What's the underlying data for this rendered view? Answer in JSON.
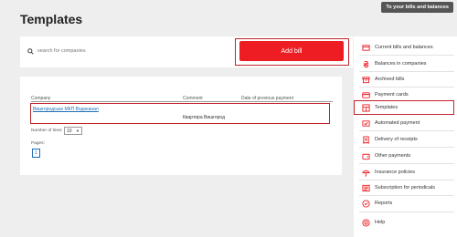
{
  "page": {
    "title": "Templates"
  },
  "header": {
    "top_link": "To your bills and balances"
  },
  "search": {
    "placeholder": "search for companies",
    "value": ""
  },
  "actions": {
    "add_bill": "Add bill"
  },
  "table": {
    "columns": [
      "Company",
      "Comment",
      "Date of previous payment"
    ],
    "rows": [
      {
        "company": "Вишгородське МКП Водоканал",
        "comment": "Квартира Вишгород",
        "date": ""
      }
    ]
  },
  "pagination": {
    "lines_label": "Number of lines",
    "lines_value": "10",
    "pages_label": "Pages:",
    "current_page": "1"
  },
  "menu": {
    "items": [
      {
        "label": "Current bills and balances",
        "icon": "bills-icon"
      },
      {
        "label": "Balances in companies",
        "icon": "hryvnia-icon"
      },
      {
        "label": "Archived bills",
        "icon": "archive-icon"
      },
      {
        "label": "Payment cards",
        "icon": "card-icon"
      },
      {
        "label": "Templates",
        "icon": "template-icon"
      },
      {
        "label": "Automated payment",
        "icon": "autopay-icon"
      },
      {
        "label": "Delivery of receipts",
        "icon": "receipt-icon"
      },
      {
        "label": "Other payments",
        "icon": "wallet-icon"
      },
      {
        "label": "Insurance policies",
        "icon": "umbrella-icon"
      },
      {
        "label": "Subscription for periodicals",
        "icon": "newspaper-icon"
      },
      {
        "label": "Reports",
        "icon": "report-icon"
      },
      {
        "label": "Help",
        "icon": "help-icon"
      }
    ]
  },
  "colors": {
    "accent": "#ee1d23",
    "link": "#1e6fb5",
    "outline": "#c2232b"
  }
}
